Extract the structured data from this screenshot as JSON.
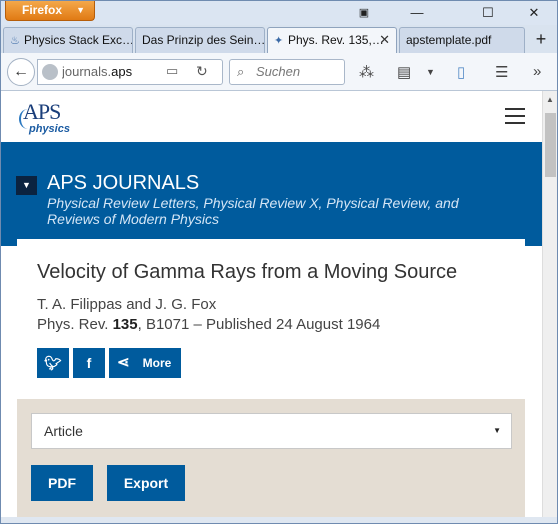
{
  "browser": {
    "app_button": "Firefox",
    "tabs": [
      {
        "label": "Physics Stack Exc…"
      },
      {
        "label": "Das Prinzip des Sein…"
      },
      {
        "label": "Phys. Rev. 135,…"
      },
      {
        "label": "apstemplate.pdf"
      }
    ],
    "url_host": "journals.",
    "url_domain": "aps",
    "search_placeholder": "Suchen"
  },
  "site": {
    "logo_text": "APS",
    "logo_sub": "physics",
    "section_title": "APS JOURNALS",
    "section_sub": "Physical Review Letters, Physical Review X, Physical Review, and Reviews of Modern Physics"
  },
  "article": {
    "title": "Velocity of Gamma Rays from a Moving Source",
    "authors": "T. A. Filippas and J. G. Fox",
    "journal": "Phys. Rev. ",
    "volume": "135",
    "cite_rest": ", B1071 – Published 24 August 1964",
    "share_more_label": "More"
  },
  "actions": {
    "select_value": "Article",
    "pdf_label": "PDF",
    "export_label": "Export"
  },
  "colors": {
    "brand_blue": "#005b9d",
    "panel_beige": "#e4ddd3"
  }
}
